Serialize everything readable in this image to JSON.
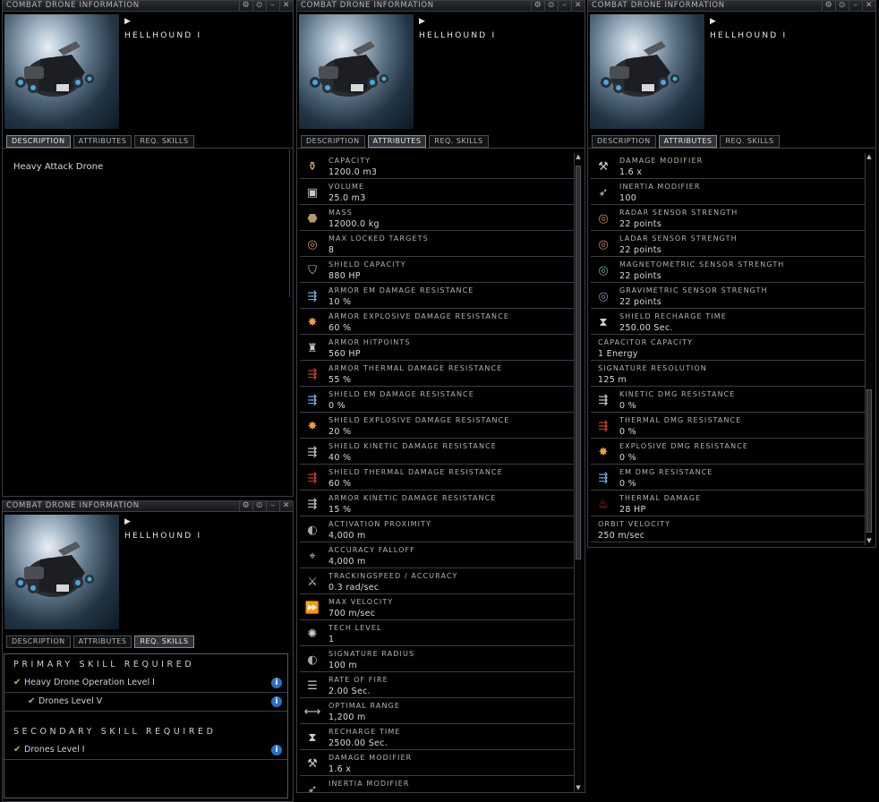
{
  "window_title": "COMBAT DRONE INFORMATION",
  "item_name": "HELLHOUND I",
  "title_buttons": [
    "⚙",
    "⊙",
    "–",
    "✕"
  ],
  "tabs": {
    "description": "DESCRIPTION",
    "attributes": "ATTRIBUTES",
    "req_skills": "REQ. SKILLS"
  },
  "description_text": "Heavy Attack Drone",
  "attributes_middle": [
    {
      "icon": "capacity-icon",
      "glyph": "⚱",
      "color": "#d8c070",
      "label": "CAPACITY",
      "value": "1200.0 m3"
    },
    {
      "icon": "volume-icon",
      "glyph": "▣",
      "color": "#c8c8c8",
      "label": "VOLUME",
      "value": "25.0 m3"
    },
    {
      "icon": "mass-icon",
      "glyph": "⬣",
      "color": "#b89868",
      "label": "MASS",
      "value": "12000.0 kg"
    },
    {
      "icon": "targets-icon",
      "glyph": "◎",
      "color": "#c8a070",
      "label": "MAX LOCKED TARGETS",
      "value": "8"
    },
    {
      "icon": "shield-capacity-icon",
      "glyph": "⛉",
      "color": "#c0c0c0",
      "label": "SHIELD CAPACITY",
      "value": "880 HP"
    },
    {
      "icon": "em-resist-icon",
      "glyph": "⇶",
      "color": "#7fb8f0",
      "label": "ARMOR EM DAMAGE RESISTANCE",
      "value": "10 %"
    },
    {
      "icon": "explosive-resist-icon",
      "glyph": "✸",
      "color": "#f0a040",
      "label": "ARMOR EXPLOSIVE DAMAGE RESISTANCE",
      "value": "60 %"
    },
    {
      "icon": "armor-hitpoints-icon",
      "glyph": "♜",
      "color": "#c8c8c8",
      "label": "ARMOR HITPOINTS",
      "value": "560 HP"
    },
    {
      "icon": "thermal-resist-icon",
      "glyph": "⇶",
      "color": "#e04030",
      "label": "ARMOR THERMAL DAMAGE RESISTANCE",
      "value": "55 %"
    },
    {
      "icon": "em-resist-icon",
      "glyph": "⇶",
      "color": "#7fb8f0",
      "label": "SHIELD EM DAMAGE RESISTANCE",
      "value": "0 %"
    },
    {
      "icon": "explosive-resist-icon",
      "glyph": "✸",
      "color": "#f0a040",
      "label": "SHIELD EXPLOSIVE DAMAGE RESISTANCE",
      "value": "20 %"
    },
    {
      "icon": "kinetic-resist-icon",
      "glyph": "⇶",
      "color": "#d0d0d0",
      "label": "SHIELD KINETIC DAMAGE RESISTANCE",
      "value": "40 %"
    },
    {
      "icon": "thermal-resist-icon",
      "glyph": "⇶",
      "color": "#e04030",
      "label": "SHIELD THERMAL DAMAGE RESISTANCE",
      "value": "60 %"
    },
    {
      "icon": "kinetic-resist-icon",
      "glyph": "⇶",
      "color": "#d0d0d0",
      "label": "ARMOR KINETIC DAMAGE RESISTANCE",
      "value": "15 %"
    },
    {
      "icon": "activation-proximity-icon",
      "glyph": "◐",
      "color": "#a8a8a8",
      "label": "ACTIVATION PROXIMITY",
      "value": "4,000 m"
    },
    {
      "icon": "accuracy-falloff-icon",
      "glyph": "⌖",
      "color": "#c8c8c8",
      "label": "ACCURACY FALLOFF",
      "value": "4,000 m"
    },
    {
      "icon": "tracking-speed-icon",
      "glyph": "⚔",
      "color": "#c8c8c8",
      "label": "TRACKINGSPEED / ACCURACY",
      "value": "0.3 rad/sec"
    },
    {
      "icon": "max-velocity-icon",
      "glyph": "⏩",
      "color": "#c8c8c8",
      "label": "MAX VELOCITY",
      "value": "700 m/sec"
    },
    {
      "icon": "tech-level-icon",
      "glyph": "✺",
      "color": "#d0d0d0",
      "label": "TECH LEVEL",
      "value": "1"
    },
    {
      "icon": "signature-radius-icon",
      "glyph": "◐",
      "color": "#a8a8a8",
      "label": "SIGNATURE RADIUS",
      "value": "100 m"
    },
    {
      "icon": "rate-of-fire-icon",
      "glyph": "☰",
      "color": "#c8c8c8",
      "label": "RATE OF FIRE",
      "value": "2.00 Sec."
    },
    {
      "icon": "optimal-range-icon",
      "glyph": "⟷",
      "color": "#c8c8c8",
      "label": "OPTIMAL RANGE",
      "value": "1,200 m"
    },
    {
      "icon": "recharge-time-icon",
      "glyph": "⧗",
      "color": "#d0d0d0",
      "label": "RECHARGE TIME",
      "value": "2500.00 Sec."
    },
    {
      "icon": "damage-modifier-icon",
      "glyph": "⚒",
      "color": "#c8c8c8",
      "label": "DAMAGE MODIFIER",
      "value": "1.6 x"
    },
    {
      "icon": "inertia-modifier-icon",
      "glyph": "➶",
      "color": "#c8c8c8",
      "label": "INERTIA MODIFIER",
      "value": ""
    }
  ],
  "attributes_right": [
    {
      "icon": "damage-modifier-icon",
      "glyph": "⚒",
      "color": "#c8c8c8",
      "label": "DAMAGE MODIFIER",
      "value": "1.6 x"
    },
    {
      "icon": "inertia-modifier-icon",
      "glyph": "➶",
      "color": "#c8c8c8",
      "label": "INERTIA MODIFIER",
      "value": "100"
    },
    {
      "icon": "radar-sensor-icon",
      "glyph": "◎",
      "color": "#c89060",
      "label": "RADAR SENSOR STRENGTH",
      "value": "22 points"
    },
    {
      "icon": "ladar-sensor-icon",
      "glyph": "◎",
      "color": "#d08070",
      "label": "LADAR SENSOR STRENGTH",
      "value": "22 points"
    },
    {
      "icon": "magnetometric-sensor-icon",
      "glyph": "◎",
      "color": "#70b080",
      "label": "MAGNETOMETRIC SENSOR STRENGTH",
      "value": "22 points"
    },
    {
      "icon": "gravimetric-sensor-icon",
      "glyph": "◎",
      "color": "#8090b0",
      "label": "GRAVIMETRIC SENSOR STRENGTH",
      "value": "22 points"
    },
    {
      "icon": "shield-recharge-icon",
      "glyph": "⧗",
      "color": "#d0d0d0",
      "label": "SHIELD RECHARGE TIME",
      "value": "250.00 Sec."
    },
    {
      "icon": "",
      "glyph": "",
      "color": "",
      "label": "CAPACITOR CAPACITY",
      "value": "1 Energy"
    },
    {
      "icon": "",
      "glyph": "",
      "color": "",
      "label": "SIGNATURE RESOLUTION",
      "value": "125 m"
    },
    {
      "icon": "kinetic-resist-icon",
      "glyph": "⇶",
      "color": "#d0d0d0",
      "label": "KINETIC DMG RESISTANCE",
      "value": "0 %"
    },
    {
      "icon": "thermal-resist-icon",
      "glyph": "⇶",
      "color": "#e04030",
      "label": "THERMAL DMG RESISTANCE",
      "value": "0 %"
    },
    {
      "icon": "explosive-resist-icon",
      "glyph": "✸",
      "color": "#f0a040",
      "label": "EXPLOSIVE DMG RESISTANCE",
      "value": "0 %"
    },
    {
      "icon": "em-resist-icon",
      "glyph": "⇶",
      "color": "#7fb8f0",
      "label": "EM DMG RESISTANCE",
      "value": "0 %"
    },
    {
      "icon": "thermal-damage-icon",
      "glyph": "♨",
      "color": "#e04030",
      "label": "THERMAL DAMAGE",
      "value": "28 HP"
    },
    {
      "icon": "",
      "glyph": "",
      "color": "",
      "label": "ORBIT VELOCITY",
      "value": "250 m/sec"
    }
  ],
  "skills": {
    "primary_header": "PRIMARY SKILL REQUIRED",
    "primary": [
      {
        "name": "Heavy Drone Operation Level I",
        "indent": 0
      },
      {
        "name": "Drones Level V",
        "indent": 1
      }
    ],
    "secondary_header": "SECONDARY SKILL REQUIRED",
    "secondary": [
      {
        "name": "Drones Level I",
        "indent": 0
      }
    ],
    "check_glyph": "✔",
    "info_glyph": "i"
  },
  "colors": {
    "check": "#7fd14e",
    "info": "#2a70c8"
  }
}
